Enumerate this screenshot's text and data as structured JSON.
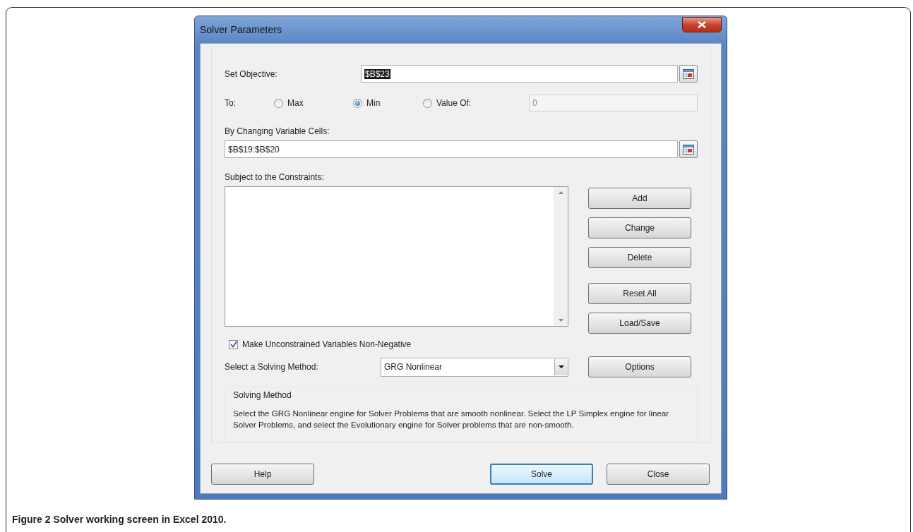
{
  "dialog": {
    "title": "Solver Parameters",
    "objective": {
      "label": "Set Objective:",
      "value": "$B$23",
      "selected": true
    },
    "to": {
      "label": "To:",
      "options": [
        {
          "label": "Max",
          "selected": false
        },
        {
          "label": "Min",
          "selected": true
        },
        {
          "label": "Value Of:",
          "selected": false
        }
      ],
      "value_of": {
        "value": "0",
        "disabled": true
      }
    },
    "variable_cells": {
      "label": "By Changing Variable Cells:",
      "value": "$B$19:$B$20"
    },
    "constraints": {
      "label": "Subject to the Constraints:"
    },
    "constraint_buttons": [
      "Add",
      "Change",
      "Delete",
      "Reset All",
      "Load/Save"
    ],
    "nonnegative": {
      "label": "Make Unconstrained Variables Non-Negative",
      "checked": true
    },
    "method": {
      "label": "Select a Solving Method:",
      "value": "GRG Nonlinear"
    },
    "options_button": "Options",
    "method_info": {
      "title": "Solving Method",
      "text": "Select the GRG Nonlinear engine for Solver Problems that are smooth nonlinear. Select the LP Simplex engine for linear Solver Problems, and select the Evolutionary engine for Solver problems that are non-smooth."
    },
    "footer_buttons": [
      {
        "label": "Help",
        "default": false
      },
      {
        "label": "Solve",
        "default": true
      },
      {
        "label": "Close",
        "default": false
      }
    ]
  },
  "caption": "Figure 2 Solver working screen in Excel 2010."
}
